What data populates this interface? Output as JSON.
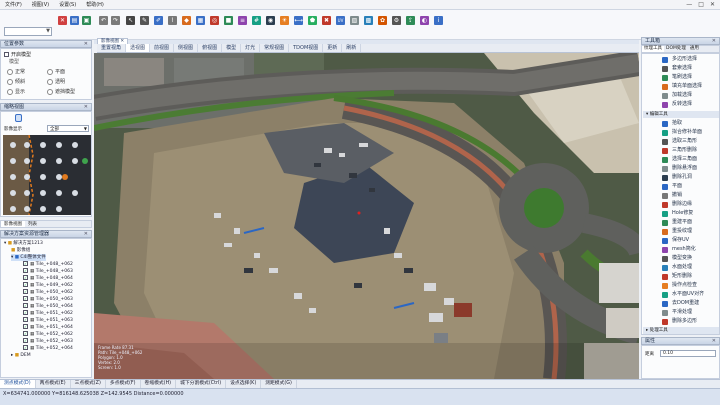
{
  "menu": [
    "文件(F)",
    "视图(V)",
    "设置(S)",
    "帮助(H)"
  ],
  "window_controls": [
    "—",
    "□",
    "✕"
  ],
  "nav_panel": {
    "title": "位置参数",
    "checkbox_label": "开启模型",
    "group_label": "模型",
    "options": [
      "正常",
      "平面",
      "倾斜",
      "透明",
      "显示",
      "遮挡模型"
    ]
  },
  "overview": {
    "title": "缩略视图",
    "filter_label": "影像显示",
    "filter_value": "全部"
  },
  "tree": {
    "tabs": [
      "影像视图",
      "列表"
    ],
    "title": "解决方案资源管理器",
    "root": "解决方案1213",
    "node1": "影像组",
    "node2": "C4I整体文件",
    "images": [
      "Tile_+048_+062",
      "Tile_+048_+063",
      "Tile_+048_+064",
      "Tile_+049_+062",
      "Tile_+050_+062",
      "Tile_+050_+063",
      "Tile_+050_+064",
      "Tile_+051_+062",
      "Tile_+051_+063",
      "Tile_+051_+064",
      "Tile_+052_+062",
      "Tile_+052_+063",
      "Tile_+052_+064"
    ],
    "last": "DEM"
  },
  "viewport_tabs": [
    "重置视角",
    "透视图",
    "前视图",
    "侧视图",
    "俯视图",
    "模型",
    "灯光",
    "常规视图",
    "TDOM视图",
    "更新",
    "刷新"
  ],
  "viewport_label": "影像视图",
  "overlay_text": [
    "Frame Rate 87.31",
    "Path: Tile_+048_+062",
    "Polygon: 1.0",
    "Vertex: 2.0",
    "Screen: 1.0"
  ],
  "tools_panel": {
    "title": "工具箱",
    "tabs": [
      "纹理工具",
      "DOM处理",
      "通用"
    ],
    "group1": [
      "多边形选择",
      "套索选择",
      "笔刷选择",
      "填充单面选择",
      "加载选择",
      "反转选择"
    ],
    "group2_title": "编辑工具",
    "group2": [
      "拾取",
      "拟合修补单面",
      "选取三角形",
      "三角形删除",
      "选择三角面",
      "删除悬浮面",
      "删除孔洞",
      "平面",
      "撤销",
      "删除边缘",
      "Hole修复",
      "重建平面",
      "重投纹理",
      "保存UV",
      "mesh简化",
      "模型变换",
      "水面处理",
      "矩形删除",
      "操作点检查",
      "水平面UV对齐",
      "去DOM重建",
      "平滑处理",
      "删除多边形"
    ],
    "group3_title": "处理工具"
  },
  "props_panel": {
    "title": "属性",
    "label": "距离",
    "value": "0.10"
  },
  "status_tabs": [
    "测点模式(D)",
    "两点模式(E)",
    "三点模式(Z)",
    "多点模式(F)",
    "卷缩模式(H)",
    "城下分割模式(Ctrl)",
    "设点选择(K)",
    "测距模式(G)"
  ],
  "status_bar": "X=634741.000000  Y=816148.625038  Z=142.9545  Distance=0.000000",
  "colors": {
    "accent_orange": "#e07a1f",
    "accent_blue": "#2b67c4",
    "road": "#6e6d69",
    "grass": "#4f7a34"
  }
}
